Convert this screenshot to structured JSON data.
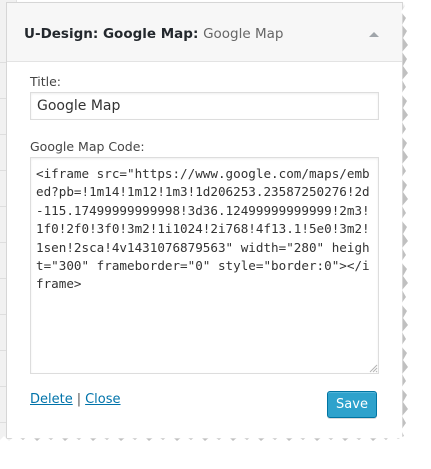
{
  "widget": {
    "title": "U-Design: Google Map",
    "subtitle": "Google Map",
    "toggle_icon": "arrow-up-icon"
  },
  "fields": {
    "title_label": "Title:",
    "title_value": "Google Map",
    "code_label": "Google Map Code:",
    "code_value": "<iframe src=\"https://www.google.com/maps/embed?pb=!1m14!1m12!1m3!1d206253.23587250276!2d-115.17499999999998!3d36.12499999999999!2m3!1f0!2f0!3f0!3m2!1i1024!2i768!4f13.1!5e0!3m2!1sen!2sca!4v1431076879563\" width=\"280\" height=\"300\" frameborder=\"0\" style=\"border:0\"></iframe>"
  },
  "actions": {
    "delete_label": "Delete",
    "separator": "|",
    "close_label": "Close",
    "save_label": "Save"
  },
  "colors": {
    "link": "#0073aa",
    "primary_button": "#2ea2cc",
    "primary_button_border": "#0074a2",
    "header_bg": "#f7f7f7"
  }
}
